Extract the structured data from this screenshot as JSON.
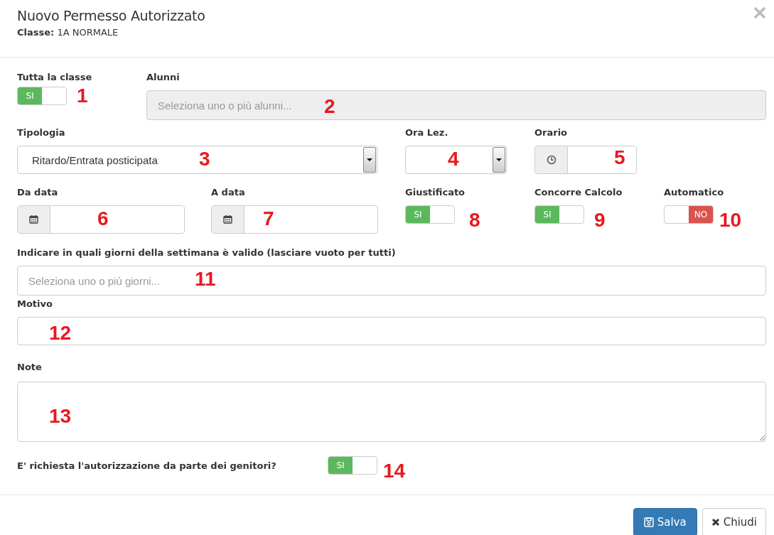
{
  "dialog": {
    "title": "Nuovo Permesso Autorizzato",
    "subtitle": "**Classe:** 1A NORMALE"
  },
  "rows": [
    [
      {
        "kind": "toggle",
        "label": "Tutta la classe",
        "on": true,
        "text": "SI",
        "marker": "1"
      },
      {
        "kind": "multiselect",
        "label": "Alunni",
        "placeholder": "Seleziona uno o più alunni...",
        "disabled": true,
        "marker": "2"
      }
    ],
    [
      {
        "kind": "select",
        "label": "Tipologia",
        "value": "Ritardo/Entrata posticipata",
        "marker": "3"
      },
      {
        "kind": "select",
        "label": "Ora Lez.",
        "marker": "4"
      },
      {
        "kind": "time",
        "label": "Orario",
        "marker": "5"
      }
    ],
    [
      {
        "kind": "date",
        "label": "Da data",
        "marker": "6"
      },
      {
        "kind": "date",
        "label": "A data",
        "marker": "7"
      },
      {
        "kind": "toggle",
        "label": "Giustificato",
        "on": true,
        "text": "SI",
        "marker": "8"
      },
      {
        "kind": "toggle",
        "label": "Concorre Calcolo",
        "on": true,
        "text": "SI",
        "marker": "9"
      },
      {
        "kind": "toggle",
        "label": "Automatico",
        "on": false,
        "text": "NO",
        "marker": "10"
      }
    ],
    [
      {
        "kind": "multiselect",
        "label": "Indicare in quali giorni della settimana è valido (lasciare vuoto per tutti)",
        "placeholder": "Seleziona uno o più giorni...",
        "disabled": false,
        "marker": "11"
      }
    ],
    [
      {
        "kind": "text",
        "label": "Motivo",
        "marker": "12"
      }
    ],
    [
      {
        "kind": "textarea",
        "label": "Note",
        "marker": "13"
      }
    ]
  ],
  "question": {
    "label": "E' richiesta l'autorizzazione da parte dei genitori?",
    "on": true,
    "text": "SI",
    "marker": "14"
  },
  "buttons": [
    {
      "kind": "primary",
      "label": "Salva"
    },
    {
      "kind": "default",
      "label": "Chiudi"
    }
  ]
}
